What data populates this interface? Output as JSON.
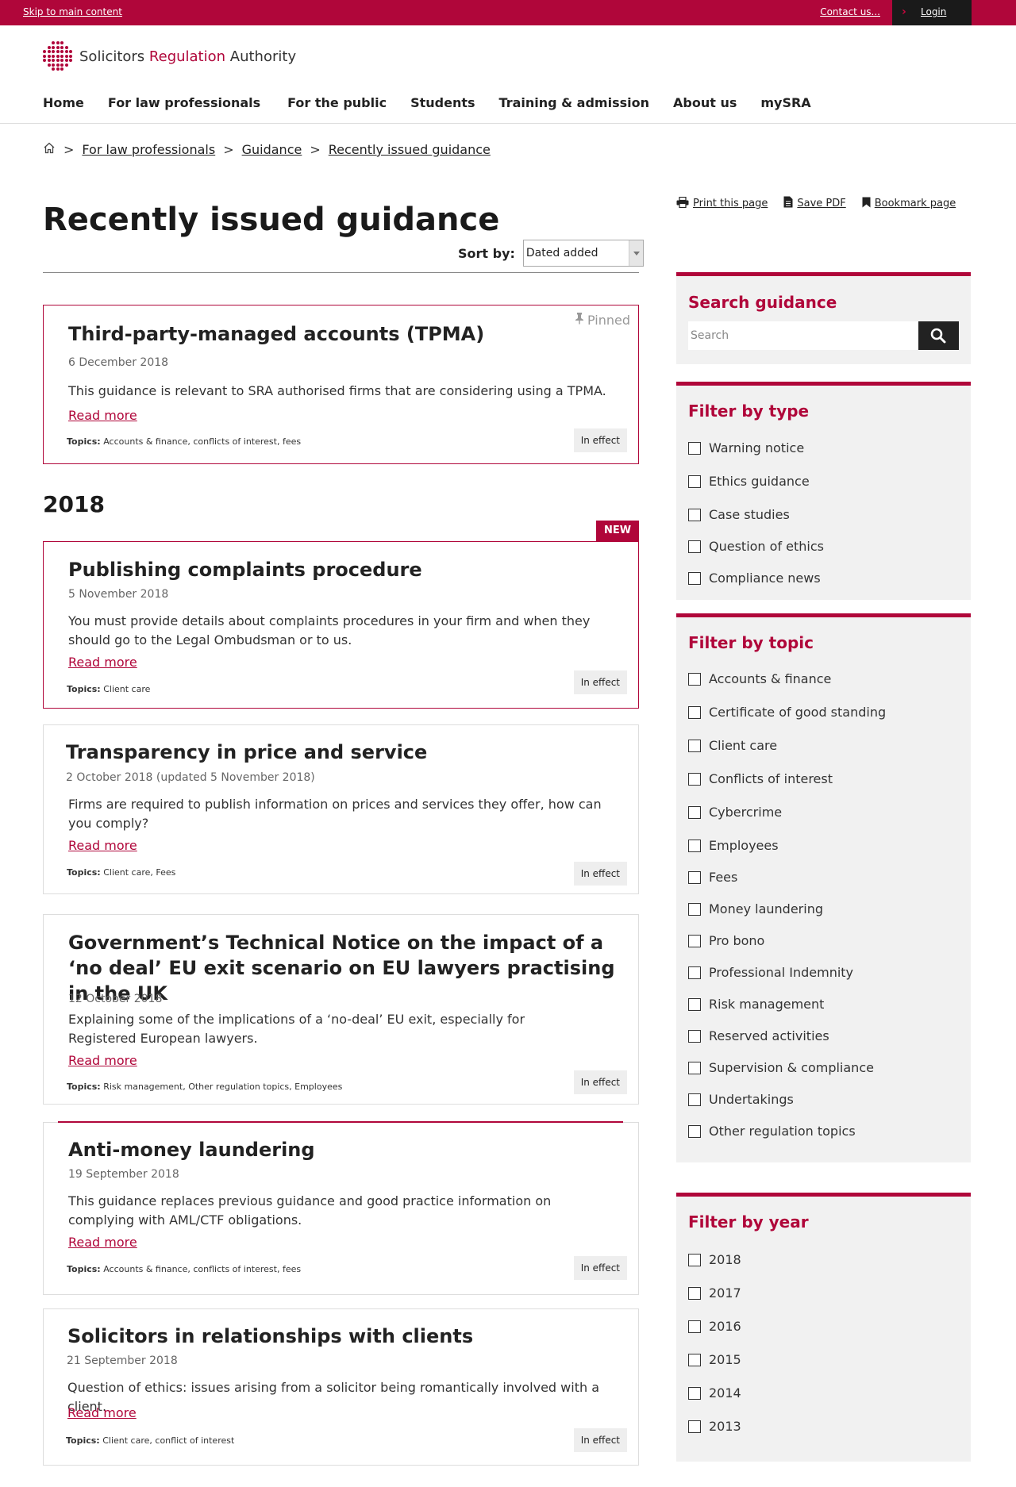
{
  "topbar": {
    "skip": "Skip to main content",
    "contact": "Contact us...",
    "login": "Login"
  },
  "brand": {
    "part1": "Solicitors",
    "part2": "Regulation",
    "part3": "Authority",
    "accent_color": "#b0063a"
  },
  "nav": [
    "Home",
    "For law professionals",
    "For the public",
    "Students",
    "Training & admission",
    "About us",
    "mySRA"
  ],
  "breadcrumb": {
    "sep": ">",
    "items": [
      "For law professionals",
      "Guidance",
      "Recently issued guidance"
    ]
  },
  "actions": {
    "print": "Print this page",
    "save": "Save PDF",
    "bookmark": "Bookmark page"
  },
  "page_title": "Recently issued guidance",
  "sort": {
    "label": "Sort by:",
    "value": "Dated added"
  },
  "pinned_label": "Pinned",
  "year_heading": "2018",
  "new_badge": "NEW",
  "topics_label": "Topics:",
  "read_more": "Read more",
  "cards": [
    {
      "title": "Third-party-managed accounts (TPMA)",
      "date": "6 December 2018",
      "desc": "This guidance is relevant to SRA authorised firms that are considering using a TPMA.",
      "topics": "Accounts & finance, conflicts of interest, fees",
      "status": "In effect"
    },
    {
      "title": "Publishing complaints procedure",
      "date": "5 November 2018",
      "desc": "You must provide details about complaints procedures in your firm and when they should go to the Legal Ombudsman or to us.",
      "topics": "Client care",
      "status": "In effect"
    },
    {
      "title": "Transparency in price and service",
      "date": "2 October 2018 (updated 5 November 2018)",
      "desc": "Firms are required to publish information on prices and services they offer, how can you comply?",
      "topics": "Client care, Fees",
      "status": "In effect"
    },
    {
      "title": "Government’s Technical Notice on the impact of a ‘no deal’ EU exit scenario on EU lawyers practising in the UK",
      "date": "12 October 2018",
      "desc": "Explaining some of the implications of a ‘no-deal’ EU exit, especially for Registered European lawyers.",
      "topics": "Risk management, Other regulation topics, Employees",
      "status": "In effect"
    },
    {
      "title": "Anti-money laundering",
      "date": "19 September 2018",
      "desc": "This guidance replaces previous guidance and good practice information on complying with AML/CTF obligations.",
      "topics": "Accounts & finance, conflicts of interest, fees",
      "status": "In effect"
    },
    {
      "title": "Solicitors in relationships with clients",
      "date": "21 September 2018",
      "desc": "Question of ethics: issues arising from a solicitor being romantically involved with a client.",
      "topics": "Client care, conflict of interest",
      "status": "In effect"
    }
  ],
  "search": {
    "title": "Search guidance",
    "placeholder": "Search"
  },
  "filter_type": {
    "title": "Filter by type",
    "options": [
      "Warning notice",
      "Ethics guidance",
      "Case studies",
      "Question of ethics",
      "Compliance news"
    ]
  },
  "filter_topic": {
    "title": "Filter by topic",
    "options": [
      "Accounts & finance",
      "Certificate of good standing",
      "Client care",
      "Conflicts of interest",
      "Cybercrime",
      "Employees",
      "Fees",
      "Money laundering",
      "Pro bono",
      "Professional Indemnity",
      "Risk management",
      "Reserved activities",
      "Supervision & compliance",
      "Undertakings",
      "Other regulation topics"
    ]
  },
  "filter_year": {
    "title": "Filter by year",
    "options": [
      "2018",
      "2017",
      "2016",
      "2015",
      "2014",
      "2013"
    ]
  }
}
